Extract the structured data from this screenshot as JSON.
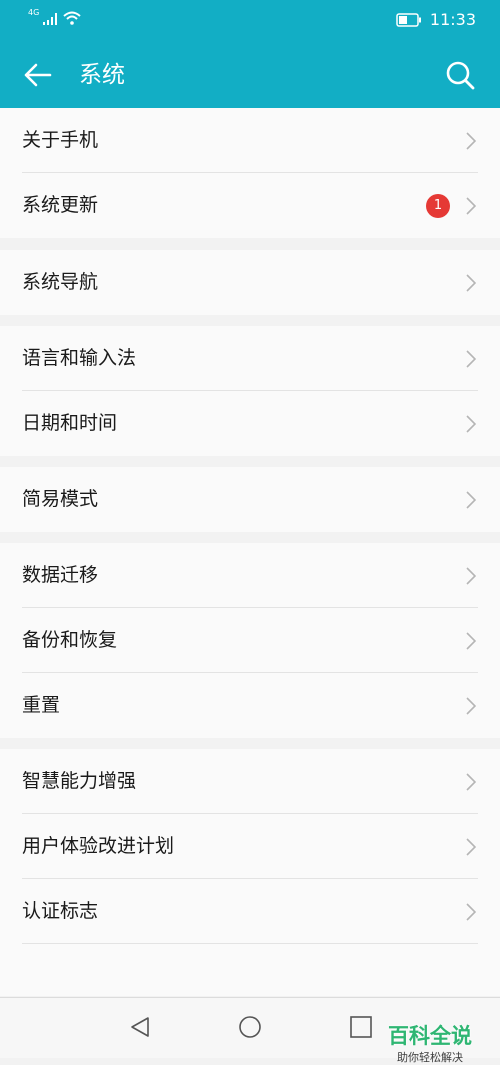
{
  "status_bar": {
    "network": "4G",
    "time": "11:33"
  },
  "header": {
    "title": "系统"
  },
  "groups": [
    {
      "items": [
        {
          "label": "关于手机"
        },
        {
          "label": "系统更新",
          "badge": "1"
        }
      ]
    },
    {
      "items": [
        {
          "label": "系统导航"
        }
      ]
    },
    {
      "items": [
        {
          "label": "语言和输入法"
        },
        {
          "label": "日期和时间"
        }
      ]
    },
    {
      "items": [
        {
          "label": "简易模式"
        }
      ]
    },
    {
      "items": [
        {
          "label": "数据迁移"
        },
        {
          "label": "备份和恢复"
        },
        {
          "label": "重置"
        }
      ]
    },
    {
      "items": [
        {
          "label": "智慧能力增强"
        },
        {
          "label": "用户体验改进计划"
        },
        {
          "label": "认证标志"
        }
      ]
    }
  ],
  "watermark": {
    "main": "百科全说",
    "sub": "助你轻松解决"
  },
  "colors": {
    "accent": "#12aec5",
    "badge": "#e53935",
    "watermark": "#2fb673"
  }
}
